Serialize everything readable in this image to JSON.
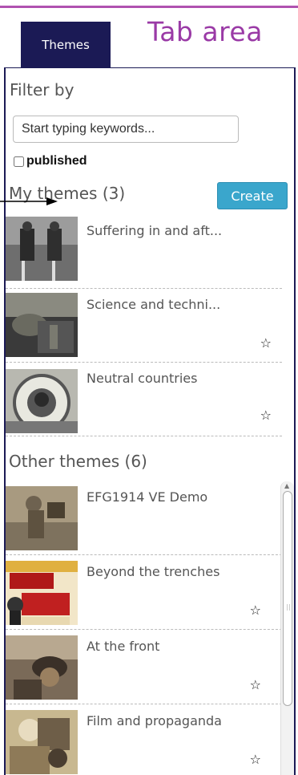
{
  "tabs": {
    "active_label": "Themes",
    "area_label": "Tab area"
  },
  "filter": {
    "title": "Filter by",
    "search_placeholder": "Start typing keywords...",
    "published_label": "published"
  },
  "my_themes": {
    "title": "My themes (3)",
    "create_label": "Create",
    "items": [
      {
        "title": "Suffering in and aft...",
        "starred": false,
        "star_glyph": ""
      },
      {
        "title": "Science and techni...",
        "starred": true,
        "star_glyph": "☆"
      },
      {
        "title": "Neutral countries",
        "starred": true,
        "star_glyph": "☆"
      }
    ]
  },
  "other_themes": {
    "title": "Other themes (6)",
    "items": [
      {
        "title": "EFG1914 VE Demo",
        "starred": false,
        "star_glyph": ""
      },
      {
        "title": "Beyond the trenches",
        "starred": true,
        "star_glyph": "☆"
      },
      {
        "title": "At the front",
        "starred": true,
        "star_glyph": "☆"
      },
      {
        "title": "Film and propaganda",
        "starred": true,
        "star_glyph": "☆"
      }
    ]
  },
  "colors": {
    "accent": "#b052b0",
    "tab_bg": "#1b1a55",
    "create_button": "#3aa6cc"
  },
  "icons": {
    "star": "star-outline-icon",
    "arrow": "annotation-arrow-icon"
  }
}
